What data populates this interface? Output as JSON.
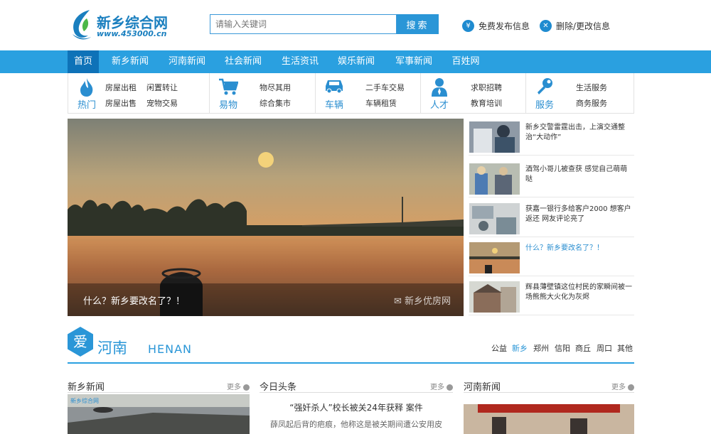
{
  "header": {
    "logo_title": "新乡综合网",
    "logo_url": "www.453000.cn",
    "search_placeholder": "请输入关键词",
    "search_button": "搜索",
    "link_publish": "免费发布信息",
    "link_publish_icon": "¥",
    "link_edit": "删除/更改信息",
    "link_edit_icon": "✕"
  },
  "nav": [
    "首页",
    "新乡新闻",
    "河南新闻",
    "社会新闻",
    "生活资讯",
    "娱乐新闻",
    "军事新闻",
    "百姓网"
  ],
  "categories": [
    {
      "name": "热门",
      "icon": "flame-icon",
      "links": [
        "房屋出租",
        "闲置转让",
        "房屋出售",
        "宠物交易"
      ]
    },
    {
      "name": "易物",
      "icon": "cart-icon",
      "links": [
        "物尽其用",
        "综合集市"
      ]
    },
    {
      "name": "车辆",
      "icon": "car-icon",
      "links": [
        "二手车交易",
        "车辆租赁"
      ]
    },
    {
      "name": "人才",
      "icon": "person-icon",
      "links": [
        "求职招聘",
        "教育培训"
      ]
    },
    {
      "name": "服务",
      "icon": "wrench-icon",
      "links": [
        "生活服务",
        "商务服务"
      ]
    }
  ],
  "hero": {
    "caption": "什么？新乡要改名了？！",
    "watermark": "新乡优房网"
  },
  "side_news": [
    {
      "text": "新乡交警雷霆出击，上演交通整治“大动作”",
      "highlight": false
    },
    {
      "text": "酒驾小哥儿被查获 感觉自己萌萌哒",
      "highlight": false
    },
    {
      "text": "获嘉一银行多给客户2000 想客户返还 网友评论亮了",
      "highlight": false
    },
    {
      "text": "什么？新乡要改名了？！",
      "highlight": true
    },
    {
      "text": "辉县薄壁镇这位村民的家瞬间被一场熊熊大火化为灰烬",
      "highlight": false
    }
  ],
  "section": {
    "icon_char": "爱",
    "title_cn": "河南",
    "title_en": "HENAN",
    "tabs": [
      "公益",
      "新乡",
      "郑州",
      "信阳",
      "商丘",
      "周口",
      "其他"
    ],
    "active_tab": "新乡"
  },
  "columns": [
    {
      "title": "新乡新闻",
      "more": "更多"
    },
    {
      "title": "今日头条",
      "more": "更多",
      "headline": "“强奸杀人”校长被关24年获释 案件",
      "desc": "薛凤起后背的疤痕，他称这是被关期间遭公安用皮"
    },
    {
      "title": "河南新闻",
      "more": "更多"
    }
  ],
  "colors": {
    "accent": "#2aa0e0",
    "nav_active": "#0e72b8",
    "highlight": "#2a8ed0"
  }
}
